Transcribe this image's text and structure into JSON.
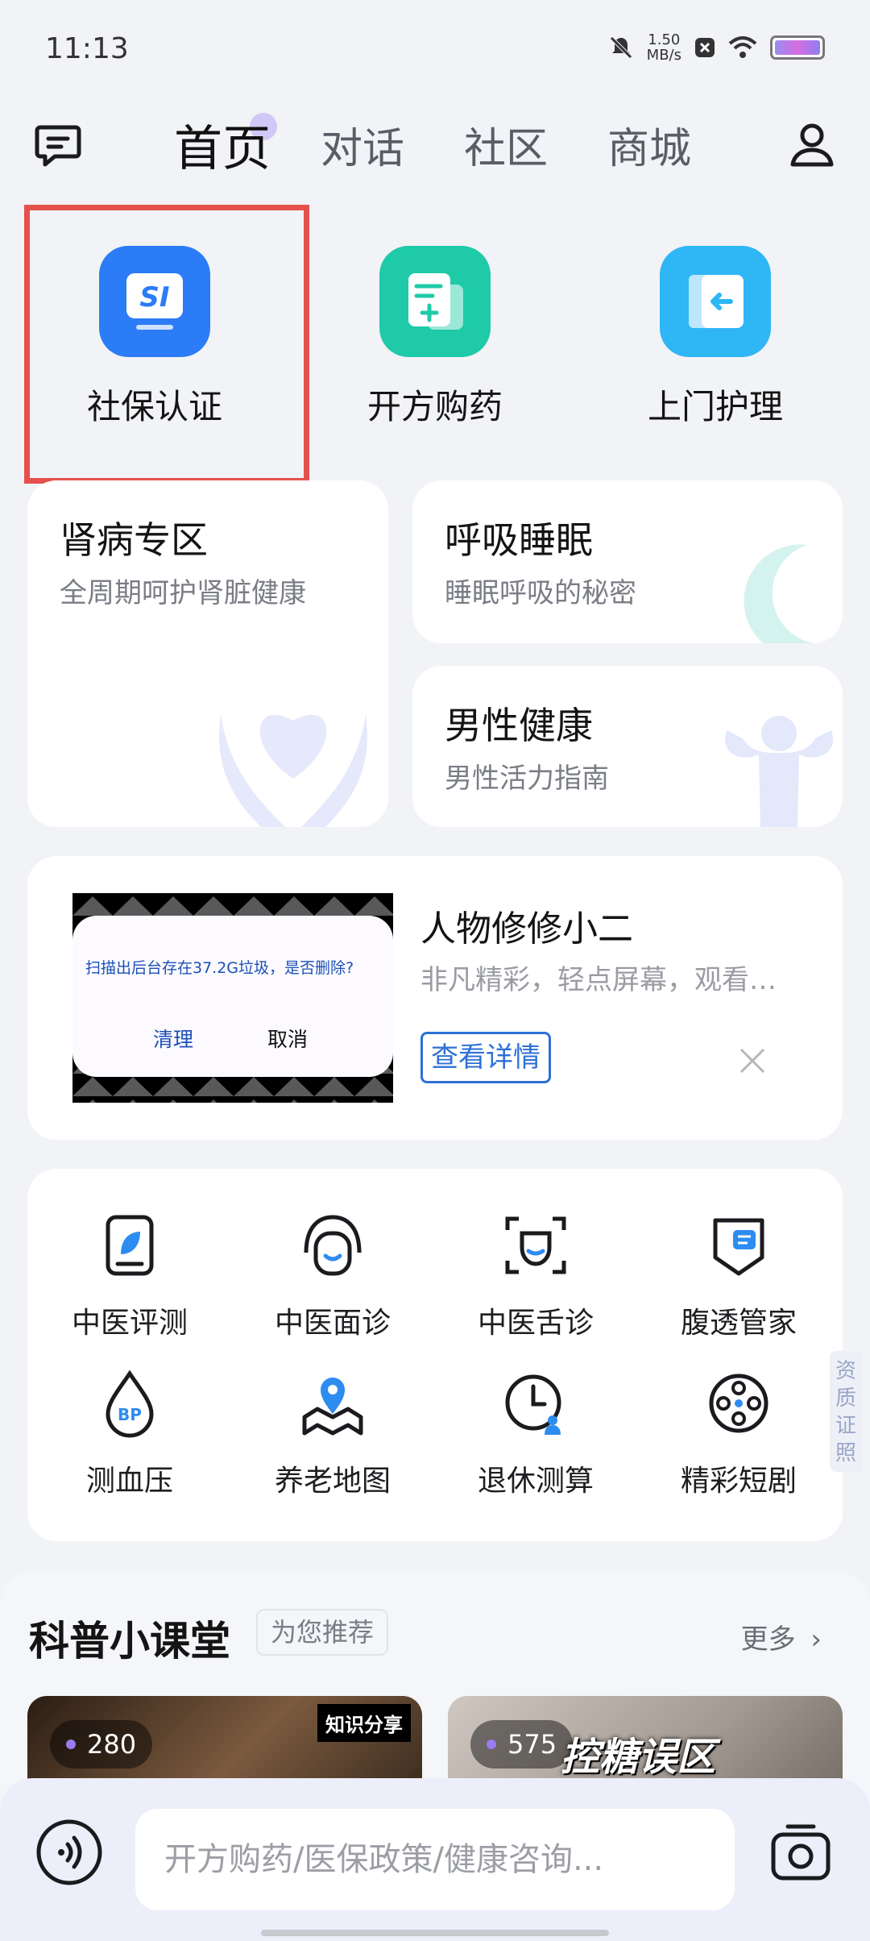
{
  "status_bar": {
    "time": "11:13",
    "net_speed": "1.50",
    "net_unit": "MB/s"
  },
  "nav": {
    "tabs": [
      {
        "label": "首页"
      },
      {
        "label": "对话"
      },
      {
        "label": "社区"
      },
      {
        "label": "商城"
      }
    ]
  },
  "quick_services": [
    {
      "label": "社保认证",
      "icon": "social-security-icon",
      "color": "#2b7cf6"
    },
    {
      "label": "开方购药",
      "icon": "prescription-icon",
      "color": "#1fcaa8"
    },
    {
      "label": "上门护理",
      "icon": "home-care-icon",
      "color": "#2fb6f5"
    }
  ],
  "feature_cards": {
    "kidney": {
      "title": "肾病专区",
      "subtitle": "全周期呵护肾脏健康"
    },
    "sleep": {
      "title": "呼吸睡眠",
      "subtitle": "睡眠呼吸的秘密"
    },
    "male": {
      "title": "男性健康",
      "subtitle": "男性活力指南"
    }
  },
  "ad": {
    "title": "人物修修小二",
    "subtitle": "非凡精彩，轻点屏幕，观看…",
    "detail_button": "查看详情",
    "image_dialog_text": "扫描出后台存在37.2G垃圾，是否删除?",
    "image_clean": "清理",
    "image_cancel": "取消"
  },
  "services": [
    {
      "label": "中医评测",
      "icon": "tcm-assessment-icon"
    },
    {
      "label": "中医面诊",
      "icon": "face-diagnosis-icon"
    },
    {
      "label": "中医舌诊",
      "icon": "tongue-diagnosis-icon"
    },
    {
      "label": "腹透管家",
      "icon": "dialysis-icon"
    },
    {
      "label": "测血压",
      "icon": "blood-pressure-icon"
    },
    {
      "label": "养老地图",
      "icon": "map-icon"
    },
    {
      "label": "退休测算",
      "icon": "clock-icon"
    },
    {
      "label": "精彩短剧",
      "icon": "film-reel-icon"
    }
  ],
  "qualification_tab": "资质证照",
  "science": {
    "title": "科普小课堂",
    "chip": "为您推荐",
    "more": "更多",
    "videos": [
      {
        "views": "280",
        "tag": "知识分享"
      },
      {
        "views": "575",
        "tag": "控糖误区"
      }
    ]
  },
  "input": {
    "placeholder": "开方购药/医保政策/健康咨询..."
  },
  "colors": {
    "accent": "#2d70d6",
    "highlight": "#e5524d"
  }
}
